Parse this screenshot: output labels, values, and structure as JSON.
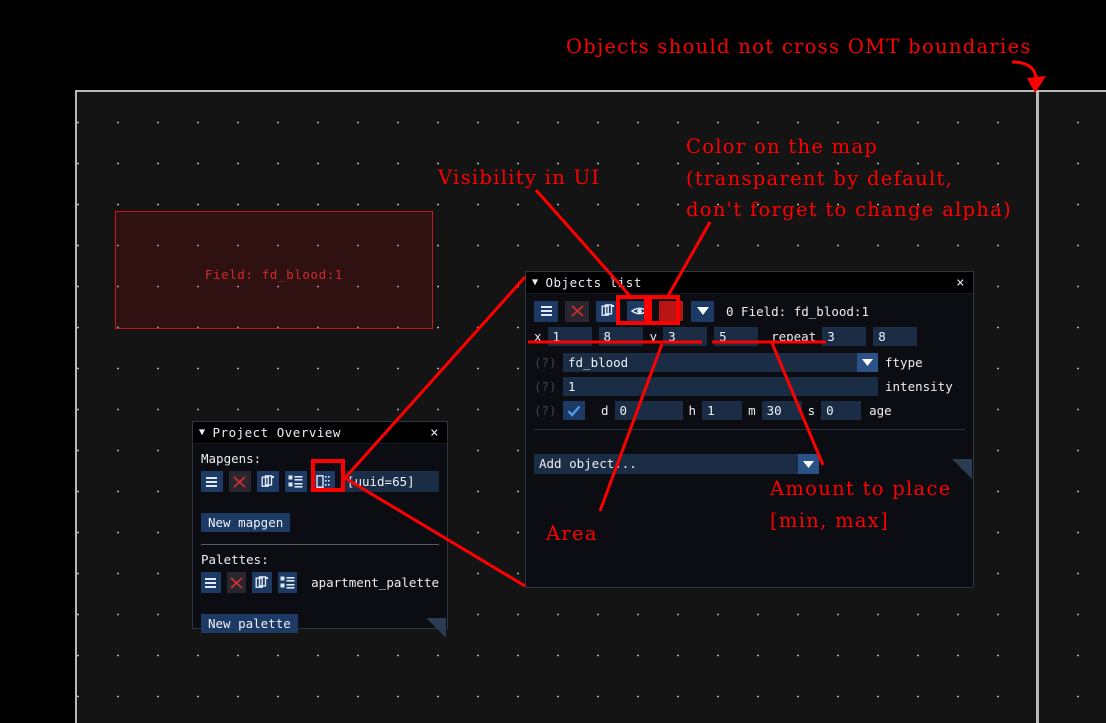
{
  "map": {
    "field_rect_label": "Field: fd_blood:1",
    "omt_boundary_color": "#b9b9b9",
    "background_color": "#141414",
    "field_color": "#c11b1b"
  },
  "objects_window": {
    "title": "Objects list",
    "caret": "▼",
    "close": "×",
    "toolbar": {
      "menu_label": "menu-icon",
      "delete_label": "delete-icon",
      "copy_label": "copy-icon",
      "visibility_label": "eye-icon",
      "color_swatch": "#b81414",
      "dropdown": "▼"
    },
    "entry_caption": "0 Field: fd_blood:1",
    "coords": {
      "x_label": "x",
      "x_min": "1",
      "x_max": "8",
      "y_label": "y",
      "y_min": "3",
      "y_max": "5",
      "repeat_label": "repeat",
      "repeat_min": "3",
      "repeat_max": "8"
    },
    "properties": [
      {
        "help": "(?)",
        "value": "fd_blood",
        "label": "ftype",
        "has_dropdown": true
      },
      {
        "help": "(?)",
        "value": "1",
        "label": "intensity",
        "has_dropdown": false
      }
    ],
    "age_row": {
      "help": "(?)",
      "checked": true,
      "d_label": "d",
      "d_value": "0",
      "h_label": "h",
      "h_value": "1",
      "m_label": "m",
      "m_value": "30",
      "s_label": "s",
      "s_value": "0",
      "label": "age"
    },
    "add_object": {
      "value": "Add object...",
      "dropdown": "▼"
    }
  },
  "project_window": {
    "title": "Project Overview",
    "caret": "▼",
    "close": "×",
    "mapgens_label": "Mapgens:",
    "mapgen_item": "[uuid=65]",
    "new_mapgen_button": "New mapgen",
    "palettes_label": "Palettes:",
    "palette_item": "apartment_palette",
    "new_palette_button": "New palette"
  },
  "annotations": {
    "omt": "Objects  should  not  cross  OMT  boundaries",
    "visibility": "Visibility  in  UI",
    "color_line1": "Color  on  the  map",
    "color_line2": "(transparent  by  default,",
    "color_line3": "don't  forget  to  change  alpha)",
    "area": "Area",
    "amount_line1": "Amount  to  place",
    "amount_line2": "[min,  max]",
    "color": "#ff0000"
  }
}
